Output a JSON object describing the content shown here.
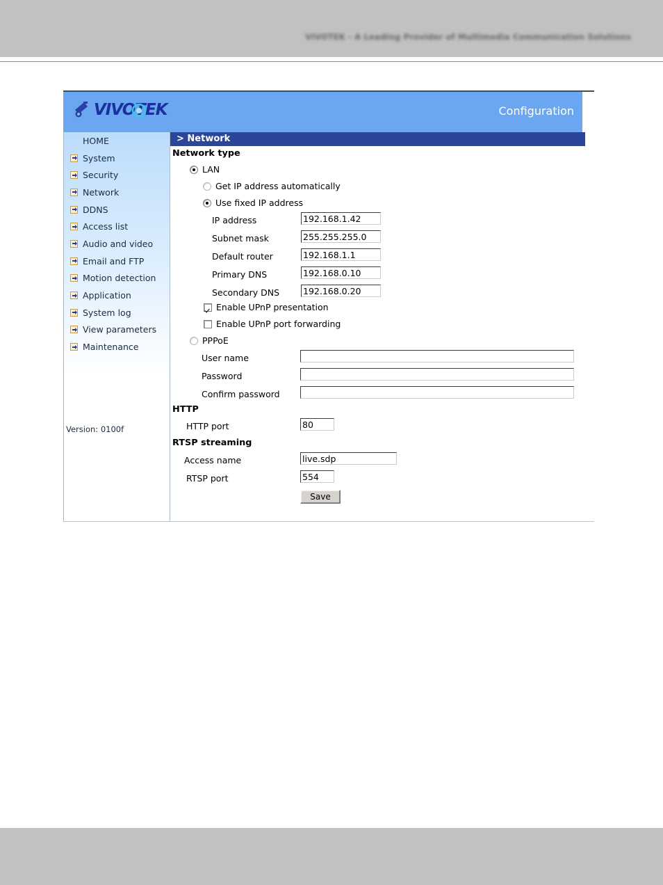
{
  "banner": {
    "tagline": "VIVOTEK - A Leading Provider of Multimedia Communication Solutions"
  },
  "app": {
    "brand": "VIVOTEK",
    "brand_logo_icon": "camera-icon",
    "header_title": "Configuration",
    "header_bg": "#6aa7f0",
    "section_bar_bg": "#2b4698",
    "section_title": "> Network"
  },
  "sidebar": {
    "version_label": "Version: 0100f",
    "items": [
      {
        "label": "HOME",
        "icon": ""
      },
      {
        "label": "System",
        "icon": "arrow-right-icon"
      },
      {
        "label": "Security",
        "icon": "arrow-right-icon"
      },
      {
        "label": "Network",
        "icon": "arrow-right-icon"
      },
      {
        "label": "DDNS",
        "icon": "arrow-right-icon"
      },
      {
        "label": "Access list",
        "icon": "arrow-right-icon"
      },
      {
        "label": "Audio and video",
        "icon": "arrow-right-icon"
      },
      {
        "label": "Email and FTP",
        "icon": "arrow-right-icon"
      },
      {
        "label": "Motion detection",
        "icon": "arrow-right-icon"
      },
      {
        "label": "Application",
        "icon": "arrow-right-icon"
      },
      {
        "label": "System log",
        "icon": "arrow-right-icon"
      },
      {
        "label": "View parameters",
        "icon": "arrow-right-icon"
      },
      {
        "label": "Maintenance",
        "icon": "arrow-right-icon"
      }
    ]
  },
  "main": {
    "network_type_heading": "Network type",
    "lan": {
      "label": "LAN",
      "selected": true
    },
    "ip_mode": {
      "auto": {
        "label": "Get IP address automatically",
        "selected": false
      },
      "fixed": {
        "label": "Use fixed IP address",
        "selected": true
      }
    },
    "fields": [
      {
        "label": "IP address",
        "value": "192.168.1.42"
      },
      {
        "label": "Subnet mask",
        "value": "255.255.255.0"
      },
      {
        "label": "Default router",
        "value": "192.168.1.1"
      },
      {
        "label": "Primary DNS",
        "value": "192.168.0.10"
      },
      {
        "label": "Secondary DNS",
        "value": "192.168.0.20"
      }
    ],
    "upnp": {
      "presentation": {
        "label": "Enable UPnP presentation",
        "checked": true
      },
      "port_forwarding": {
        "label": "Enable UPnP port forwarding",
        "checked": false
      }
    },
    "pppoe": {
      "label": "PPPoE",
      "selected": false,
      "username": {
        "label": "User name",
        "value": ""
      },
      "password": {
        "label": "Password",
        "value": ""
      },
      "confirm": {
        "label": "Confirm password",
        "value": ""
      }
    },
    "http": {
      "heading": "HTTP",
      "port": {
        "label": "HTTP port",
        "value": "80"
      }
    },
    "rtsp": {
      "heading": "RTSP streaming",
      "access_name": {
        "label": "Access name",
        "value": "live.sdp"
      },
      "port": {
        "label": "RTSP port",
        "value": "554"
      }
    },
    "save_label": "Save"
  }
}
